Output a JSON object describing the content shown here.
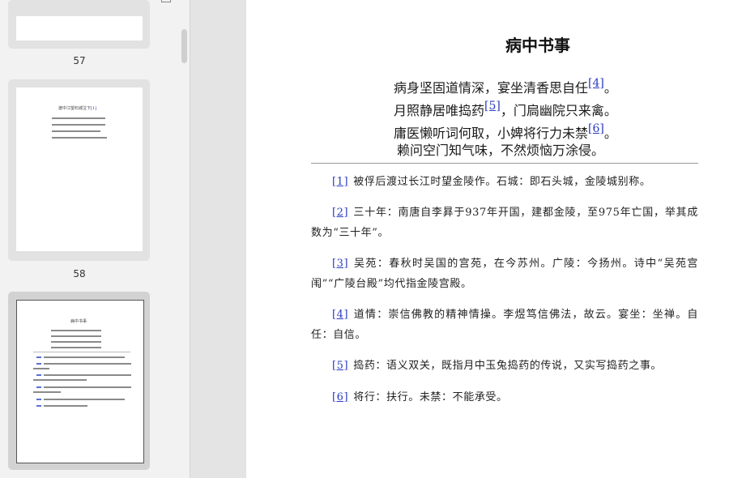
{
  "sidebar": {
    "thumbnails": [
      {
        "page": "57"
      },
      {
        "page": "58",
        "title": "渡中江望石城泣下",
        "ref": "[1]"
      },
      {
        "page": "",
        "title": "病中书事"
      }
    ]
  },
  "document": {
    "title": "病中书事",
    "poem": [
      {
        "text": "病身坚固道情深，宴坐清香思自任",
        "ref": "[4]",
        "end": "。"
      },
      {
        "text": "月照静居唯捣药",
        "ref": "[5]",
        "end": "，门扃幽院只来禽。"
      },
      {
        "text": "庸医懒听词何取，小婢将行力未禁",
        "ref": "[6]",
        "end": "。"
      },
      {
        "text": "赖问空门知气味，不然烦恼万涂侵。",
        "ref": "",
        "end": ""
      }
    ],
    "notes": [
      {
        "num": "[1]",
        "text": "被俘后渡过长江时望金陵作。石城：即石头城，金陵城别称。"
      },
      {
        "num": "[2]",
        "text": "三十年：南唐自李昪于937年开国，建都金陵，至975年亡国，举其成数为“三十年”。"
      },
      {
        "num": "[3]",
        "text": "吴苑：春秋时吴国的宫苑，在今苏州。广陵：今扬州。诗中“吴苑宫闱”“广陵台殿”均代指金陵宫殿。"
      },
      {
        "num": "[4]",
        "text": "道情：崇信佛教的精神情操。李煜笃信佛法，故云。宴坐：坐禅。自任：自信。"
      },
      {
        "num": "[5]",
        "text": "捣药：语义双关，既指月中玉兔捣药的传说，又实写捣药之事。"
      },
      {
        "num": "[6]",
        "text": "将行：扶行。未禁：不能承受。"
      }
    ]
  }
}
